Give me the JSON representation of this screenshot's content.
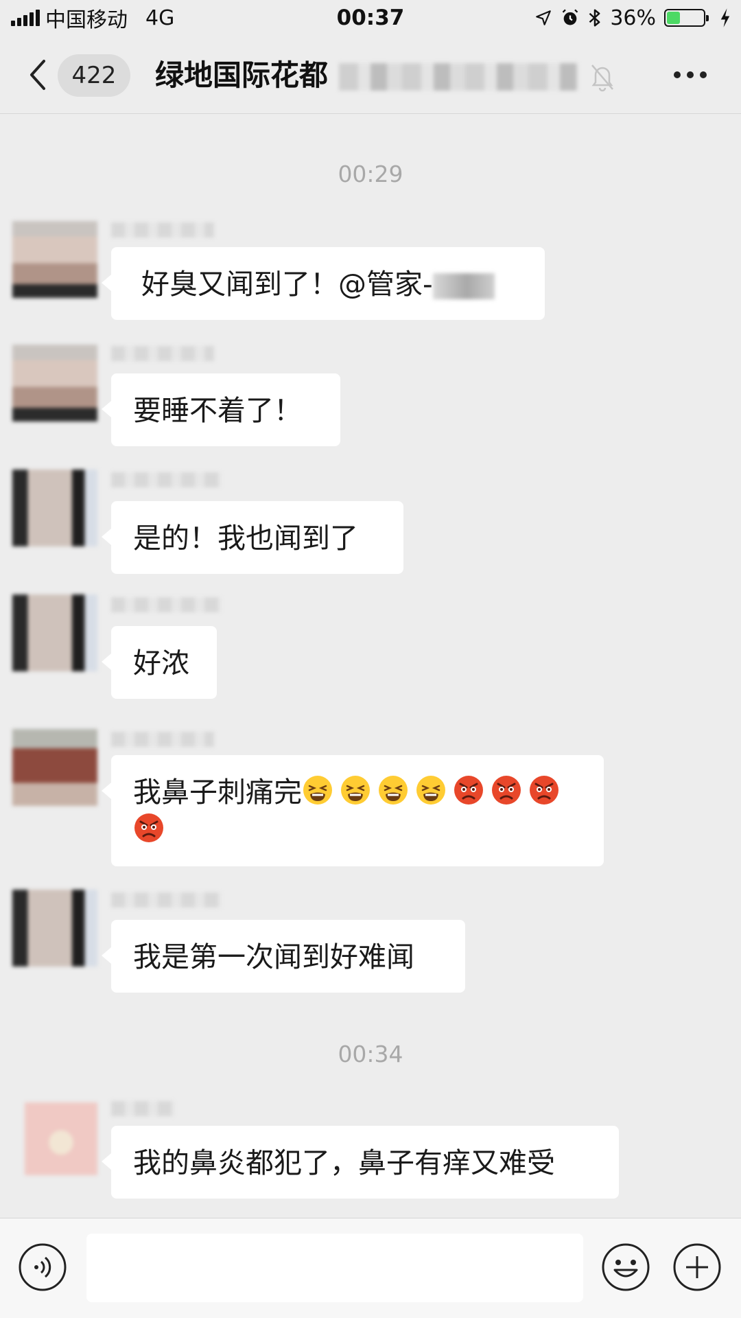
{
  "status_bar": {
    "carrier": "中国移动",
    "network": "4G",
    "time": "00:37",
    "battery": "36%",
    "battery_level": 0.36,
    "icons": [
      "signal-icon",
      "location-icon",
      "alarm-icon",
      "bluetooth-icon",
      "battery-icon",
      "charging-icon"
    ]
  },
  "nav": {
    "back_icon": "chevron-left-icon",
    "unread_count": "422",
    "title": "绿地国际花都",
    "mute_icon": "bell-off-icon",
    "more_icon": "more-icon"
  },
  "chat": {
    "timestamps": [
      "00:29",
      "00:34"
    ],
    "messages": [
      {
        "text": "好臭又闻到了！@管家-",
        "mention_hidden": true
      },
      {
        "text": "要睡不着了！"
      },
      {
        "text": "是的！我也闻到了"
      },
      {
        "text": "好浓"
      },
      {
        "text": "我鼻子刺痛完",
        "emojis": [
          "tired-face-emoji",
          "tired-face-emoji",
          "tired-face-emoji",
          "tired-face-emoji",
          "angry-face-emoji",
          "angry-face-emoji",
          "angry-face-emoji",
          "angry-face-emoji"
        ]
      },
      {
        "text": "我是第一次闻到好难闻"
      },
      {
        "text": "我的鼻炎都犯了，鼻子有痒又难受"
      }
    ]
  },
  "input_bar": {
    "voice_icon": "voice-icon",
    "emoji_icon": "emoji-icon",
    "plus_icon": "plus-icon",
    "value": ""
  },
  "colors": {
    "background": "#ededed",
    "bubble": "#ffffff",
    "timestamp": "#a8a8a8",
    "battery_fill": "#4cd964"
  }
}
